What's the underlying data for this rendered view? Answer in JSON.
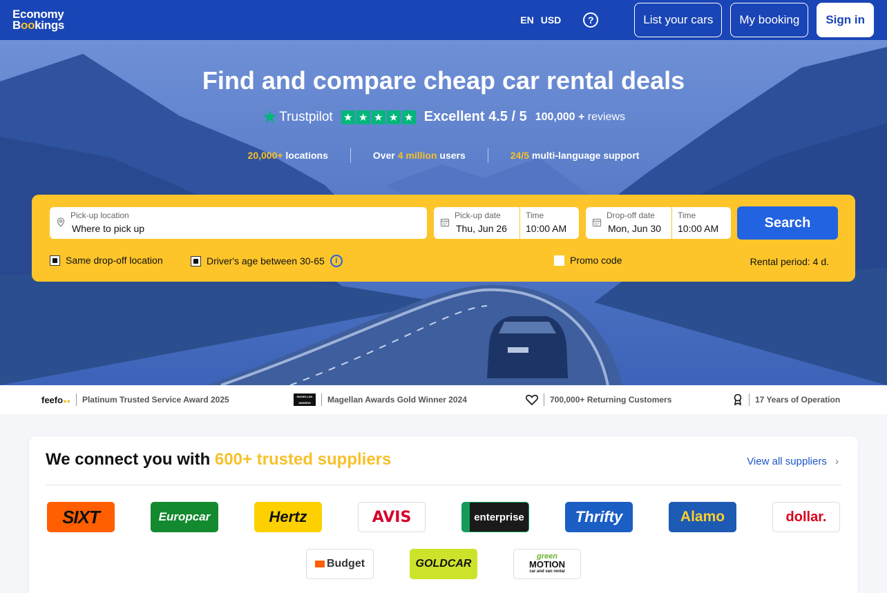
{
  "header": {
    "logo_line1": "Economy",
    "logo_line2_a": "B",
    "logo_line2_b": "oo",
    "logo_line2_c": "kings",
    "lang": "EN",
    "currency": "USD",
    "help_icon": "?",
    "list_cars": "List your cars",
    "my_booking": "My booking",
    "sign_in": "Sign in"
  },
  "hero": {
    "title": "Find and compare cheap car rental deals",
    "trustpilot": "Trustpilot",
    "rating_text": "Excellent 4.5 / 5",
    "rating_stars": 4.5,
    "reviews_count": "100,000 +",
    "reviews_label": "reviews",
    "stat1_highlight": "20,000+",
    "stat1_text": " locations",
    "stat2_pre": "Over ",
    "stat2_highlight": "4 million",
    "stat2_post": " users",
    "stat3_highlight": "24/5",
    "stat3_text": " multi-language support"
  },
  "search": {
    "pickup_label": "Pick-up location",
    "pickup_placeholder": "Where to pick up",
    "pickup_date_label": "Pick-up date",
    "pickup_date": "Thu, Jun 26",
    "pickup_time_label": "Time",
    "pickup_time": "10:00 AM",
    "dropoff_date_label": "Drop-off date",
    "dropoff_date": "Mon, Jun 30",
    "dropoff_time_label": "Time",
    "dropoff_time": "10:00 AM",
    "search_button": "Search",
    "same_dropoff": "Same drop-off location",
    "driver_age": "Driver's age between 30-65",
    "promo": "Promo code",
    "rental_period": "Rental period: 4 d."
  },
  "awards": {
    "feefo": "feefo",
    "feefo_award": "Platinum Trusted Service Award 2025",
    "magellan_logo": "MAGELLAN AWARDS",
    "magellan": "Magellan Awards Gold Winner 2024",
    "customers": "700,000+ Returning Customers",
    "years": "17 Years of Operation"
  },
  "suppliers": {
    "title_pre": "We connect you with ",
    "title_highlight": "600+ trusted suppliers",
    "view_all": "View all suppliers",
    "logos": [
      "SIXT",
      "Europcar",
      "Hertz",
      "AVIS",
      "enterprise",
      "Thrifty",
      "Alamo",
      "dollar.",
      "Budget",
      "GOLDCAR",
      "green",
      "MOTION",
      "car and van rental"
    ]
  },
  "colors": {
    "brand_blue": "#1a45b6",
    "accent_yellow": "#fdc52a",
    "button_blue": "#2263e1",
    "trustpilot_green": "#00b67a"
  }
}
